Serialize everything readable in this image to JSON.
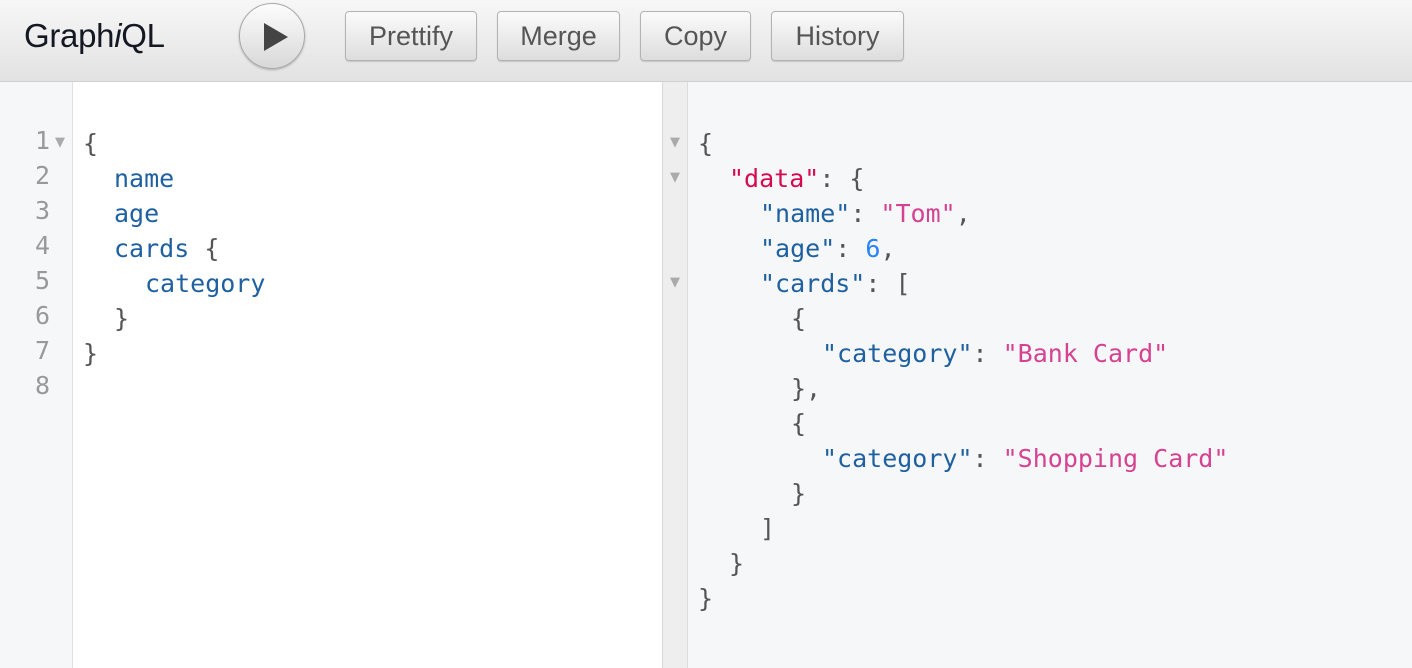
{
  "toolbar": {
    "logo_prefix": "Graph",
    "logo_italic": "i",
    "logo_suffix": "QL",
    "buttons": [
      "Prettify",
      "Merge",
      "Copy",
      "History"
    ]
  },
  "query_editor": {
    "line_numbers": [
      "1",
      "2",
      "3",
      "4",
      "5",
      "6",
      "7",
      "8"
    ],
    "lines": [
      "{",
      "name",
      "age",
      "cards",
      "{",
      "category",
      "}",
      "}"
    ]
  },
  "result_viewer": {
    "open_brace": "{",
    "data_key": "\"data\"",
    "colon": ": ",
    "name_key": "\"name\"",
    "name_value": "\"Tom\"",
    "age_key": "\"age\"",
    "age_value": "6",
    "cards_key": "\"cards\"",
    "open_bracket": "[",
    "item_open": "{",
    "category_key": "\"category\"",
    "card1_value": "\"Bank Card\"",
    "item_close_comma": "},",
    "card2_value": "\"Shopping Card\"",
    "item_close": "}",
    "close_bracket": "]",
    "close_brace": "}",
    "comma": ","
  },
  "colors": {
    "field": "#1f61a0",
    "string": "#d64292",
    "number": "#2882f9",
    "data_key": "#d60a4e"
  },
  "icons": {
    "run": "play-icon",
    "fold": "fold-arrow-icon"
  }
}
